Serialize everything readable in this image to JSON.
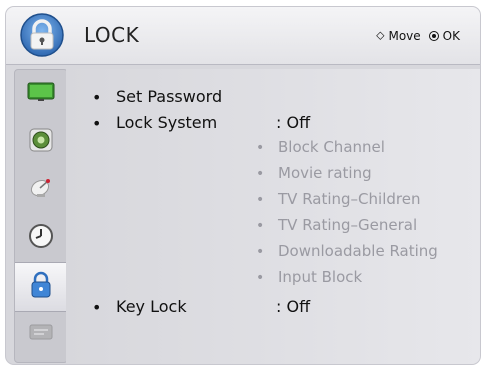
{
  "header": {
    "title": "LOCK",
    "nav_move": "Move",
    "nav_ok": "OK"
  },
  "sidebar": {
    "items": [
      {
        "icon": "picture-icon"
      },
      {
        "icon": "speaker-icon"
      },
      {
        "icon": "satellite-icon"
      },
      {
        "icon": "clock-icon"
      },
      {
        "icon": "lock-icon",
        "active": true
      },
      {
        "icon": "option-icon"
      }
    ]
  },
  "menu": {
    "set_password": "Set Password",
    "lock_system": {
      "label": "Lock System",
      "value": ": Off"
    },
    "sub_items": [
      "Block Channel",
      "Movie rating",
      "TV Rating–Children",
      "TV Rating–General",
      "Downloadable Rating",
      "Input Block"
    ],
    "key_lock": {
      "label": "Key Lock",
      "value": ": Off"
    }
  },
  "colors": {
    "accent_blue": "#3a7dc6",
    "disabled_text": "#9a9aa2"
  }
}
